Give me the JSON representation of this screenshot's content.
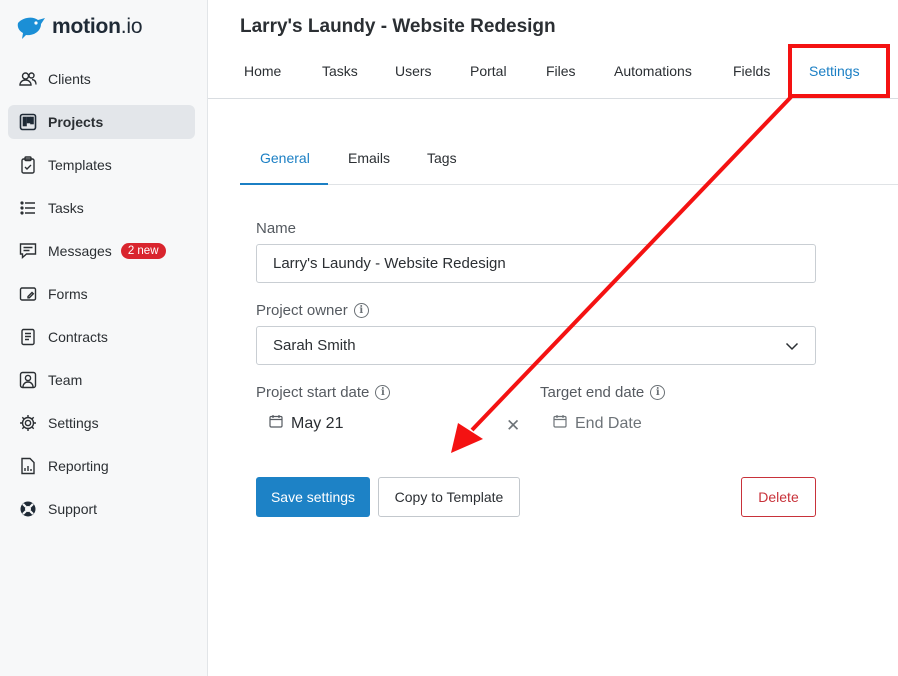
{
  "app": {
    "logo_main": "motion",
    "logo_tld": ".io",
    "brand_color": "#1b7fc4"
  },
  "sidebar": {
    "items": [
      {
        "label": "Clients",
        "icon": "users-icon"
      },
      {
        "label": "Projects",
        "icon": "projects-board-icon",
        "active": true
      },
      {
        "label": "Templates",
        "icon": "clipboard-icon"
      },
      {
        "label": "Tasks",
        "icon": "list-icon"
      },
      {
        "label": "Messages",
        "icon": "message-icon",
        "badge": "2 new"
      },
      {
        "label": "Forms",
        "icon": "form-icon"
      },
      {
        "label": "Contracts",
        "icon": "document-icon"
      },
      {
        "label": "Team",
        "icon": "team-icon"
      },
      {
        "label": "Settings",
        "icon": "gear-icon"
      },
      {
        "label": "Reporting",
        "icon": "chart-file-icon"
      },
      {
        "label": "Support",
        "icon": "lifebuoy-icon"
      }
    ]
  },
  "header": {
    "title": "Larry's Laundy - Website Redesign",
    "tabs": [
      "Home",
      "Tasks",
      "Users",
      "Portal",
      "Files",
      "Automations",
      "Fields",
      "Settings"
    ],
    "active_tab": "Settings"
  },
  "subtabs": {
    "items": [
      "General",
      "Emails",
      "Tags"
    ],
    "active": "General"
  },
  "form": {
    "name_label": "Name",
    "name_value": "Larry's Laundy - Website Redesign",
    "owner_label": "Project owner",
    "owner_value": "Sarah Smith",
    "start_label": "Project start date",
    "start_value": "May 21",
    "end_label": "Target end date",
    "end_placeholder": "End Date"
  },
  "actions": {
    "save": "Save settings",
    "copy": "Copy to Template",
    "delete": "Delete"
  },
  "annotation": {
    "color": "#f41212"
  }
}
